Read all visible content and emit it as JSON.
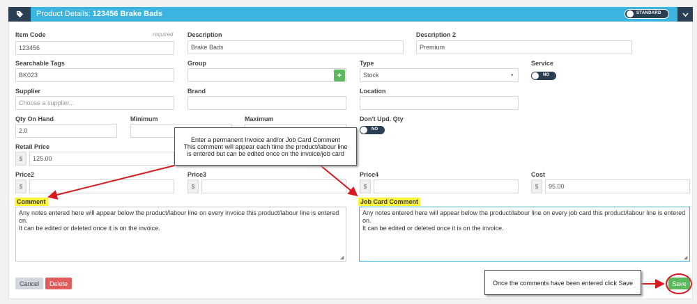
{
  "header": {
    "title_prefix": "Product Details:",
    "title_product": "123456 Brake Bads",
    "standard_toggle": "STANDARD",
    "tag_icon": "tag-icon",
    "chevron_icon": "chevron-down-icon"
  },
  "fields": {
    "item_code": {
      "label": "Item Code",
      "required": "required",
      "value": "123456"
    },
    "description": {
      "label": "Description",
      "value": "Brake Bads"
    },
    "description2": {
      "label": "Description 2",
      "value": "Premium"
    },
    "searchable_tags": {
      "label": "Searchable Tags",
      "value": "BK023"
    },
    "group": {
      "label": "Group",
      "value": "",
      "add": "+"
    },
    "type": {
      "label": "Type",
      "value": "Stock",
      "caret": "▾"
    },
    "service": {
      "label": "Service",
      "toggle": "NO"
    },
    "supplier": {
      "label": "Supplier",
      "placeholder": "Choose a supplier..."
    },
    "brand": {
      "label": "Brand",
      "value": ""
    },
    "location": {
      "label": "Location",
      "value": ""
    },
    "qty_on_hand": {
      "label": "Qty On Hand",
      "value": "2.0"
    },
    "minimum": {
      "label": "Minimum",
      "value": ""
    },
    "maximum": {
      "label": "Maximum",
      "value": ""
    },
    "dont_upd_qty": {
      "label": "Don't Upd. Qty",
      "toggle": "NO"
    },
    "retail_price": {
      "label": "Retail Price",
      "currency": "$",
      "value": "125.00"
    },
    "price2": {
      "label": "Price2",
      "currency": "$",
      "value": ""
    },
    "price3": {
      "label": "Price3",
      "currency": "$",
      "value": ""
    },
    "price4": {
      "label": "Price4",
      "currency": "$",
      "value": ""
    },
    "cost": {
      "label": "Cost",
      "currency": "$",
      "value": "95.00"
    }
  },
  "comment": {
    "label": "Comment",
    "text": "Any notes entered here will appear below the product/labour line on every invoice this product/labour line is entered on.\nIt can be edited or deleted once it is on the invoice."
  },
  "job_card_comment": {
    "label": "Job Card Comment",
    "text": "Any notes entered here will appear below the product/labour line on every job card this product/labour line is entered on.\nIt can be edited or deleted once it is on the invoice."
  },
  "buttons": {
    "cancel": "Cancel",
    "delete": "Delete",
    "save": "Save"
  },
  "callouts": {
    "top_line1": "Enter a permanent Invoice and/or Job Card Comment",
    "top_line2": "This comment will appear each time the product/labour line",
    "top_line3": "is entered but can be edited once on the invoice/job card",
    "save_note": "Once the comments have been entered click Save"
  },
  "colors": {
    "header": "#3bb5df",
    "dark": "#2a3f54",
    "highlight": "#fff53b",
    "annotation": "#d9181f",
    "save": "#5cb85c",
    "delete": "#e05d5d"
  }
}
